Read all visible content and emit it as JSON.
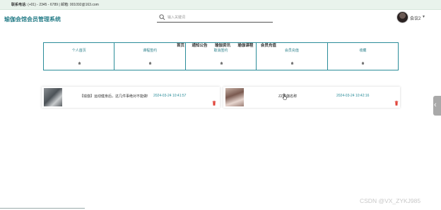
{
  "topbar": {
    "contact_label": "联系电话:",
    "contact_value": "(+01) - 2345 - 6789 | 邮箱: 001092@163.com"
  },
  "header": {
    "site_title": "瑜伽会馆会员管理系统"
  },
  "search": {
    "placeholder": "输入关键词"
  },
  "user": {
    "name": "会议2",
    "caret": "▼"
  },
  "nav": {
    "items": [
      "首页",
      "通知公告",
      "瑜伽资讯",
      "瑜伽课程",
      "会员充值"
    ]
  },
  "cards": [
    {
      "label": "个人首页",
      "icon": "home-icon"
    },
    {
      "label": "课程签约",
      "icon": "home-icon"
    },
    {
      "label": "取消签约",
      "icon": "home-icon"
    },
    {
      "label": "会员充值",
      "icon": "home-icon"
    },
    {
      "label": "收藏",
      "icon": "home-icon"
    }
  ],
  "items": [
    {
      "title": "【瑜伽】运动健身后，这几件事绝对不能做!",
      "date": "2024-03-24 10:41:57",
      "icon": "trash-icon"
    },
    {
      "title": "ZZ瑜伽名称",
      "date": "2024-03-24 10:42:16",
      "icon": "trash-icon"
    }
  ],
  "side_tab": {
    "glyph": "‹"
  },
  "watermark": "CSDN @VX_ZYKJ985",
  "colors": {
    "accent": "#2a8c99",
    "title": "#2a7f8a",
    "delete": "#e0443a",
    "topbar": "#e9f3ec"
  }
}
